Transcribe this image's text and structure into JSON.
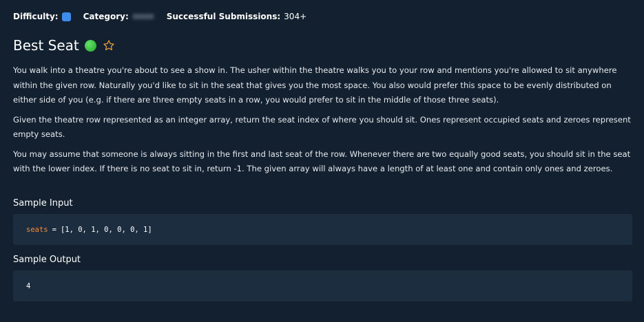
{
  "meta": {
    "difficulty_label": "Difficulty:",
    "difficulty_color": "#3b8ef0",
    "category_label": "Category:",
    "submissions_label": "Successful Submissions:",
    "submissions_value": "304+"
  },
  "problem": {
    "title": "Best Seat",
    "status_color": "#33c13a",
    "favorite_icon": "star-outline-icon",
    "paragraphs": [
      "You walk into a theatre you're about to see a show in. The usher within the theatre walks you to your row and mentions you're allowed to sit anywhere within the given row. Naturally you'd like to sit in the seat that gives you the most space. You also would prefer this space to be evenly distributed on either side of you (e.g. if there are three empty seats in a row, you would prefer to sit in the middle of those three seats).",
      "Given the theatre row represented as an integer array, return the seat index of where you should sit. Ones represent occupied seats and zeroes represent empty seats.",
      "You may assume that someone is always sitting in the first and last seat of the row. Whenever there are two equally good seats, you should sit in the seat with the lower index. If there is no seat to sit in, return -1. The given array will always have a length of at least one and contain only ones and zeroes."
    ]
  },
  "sample_input": {
    "label": "Sample Input",
    "var_name": "seats",
    "operator": "=",
    "value": "[1, 0, 1, 0, 0, 0, 1]"
  },
  "sample_output": {
    "label": "Sample Output",
    "value": "4"
  }
}
